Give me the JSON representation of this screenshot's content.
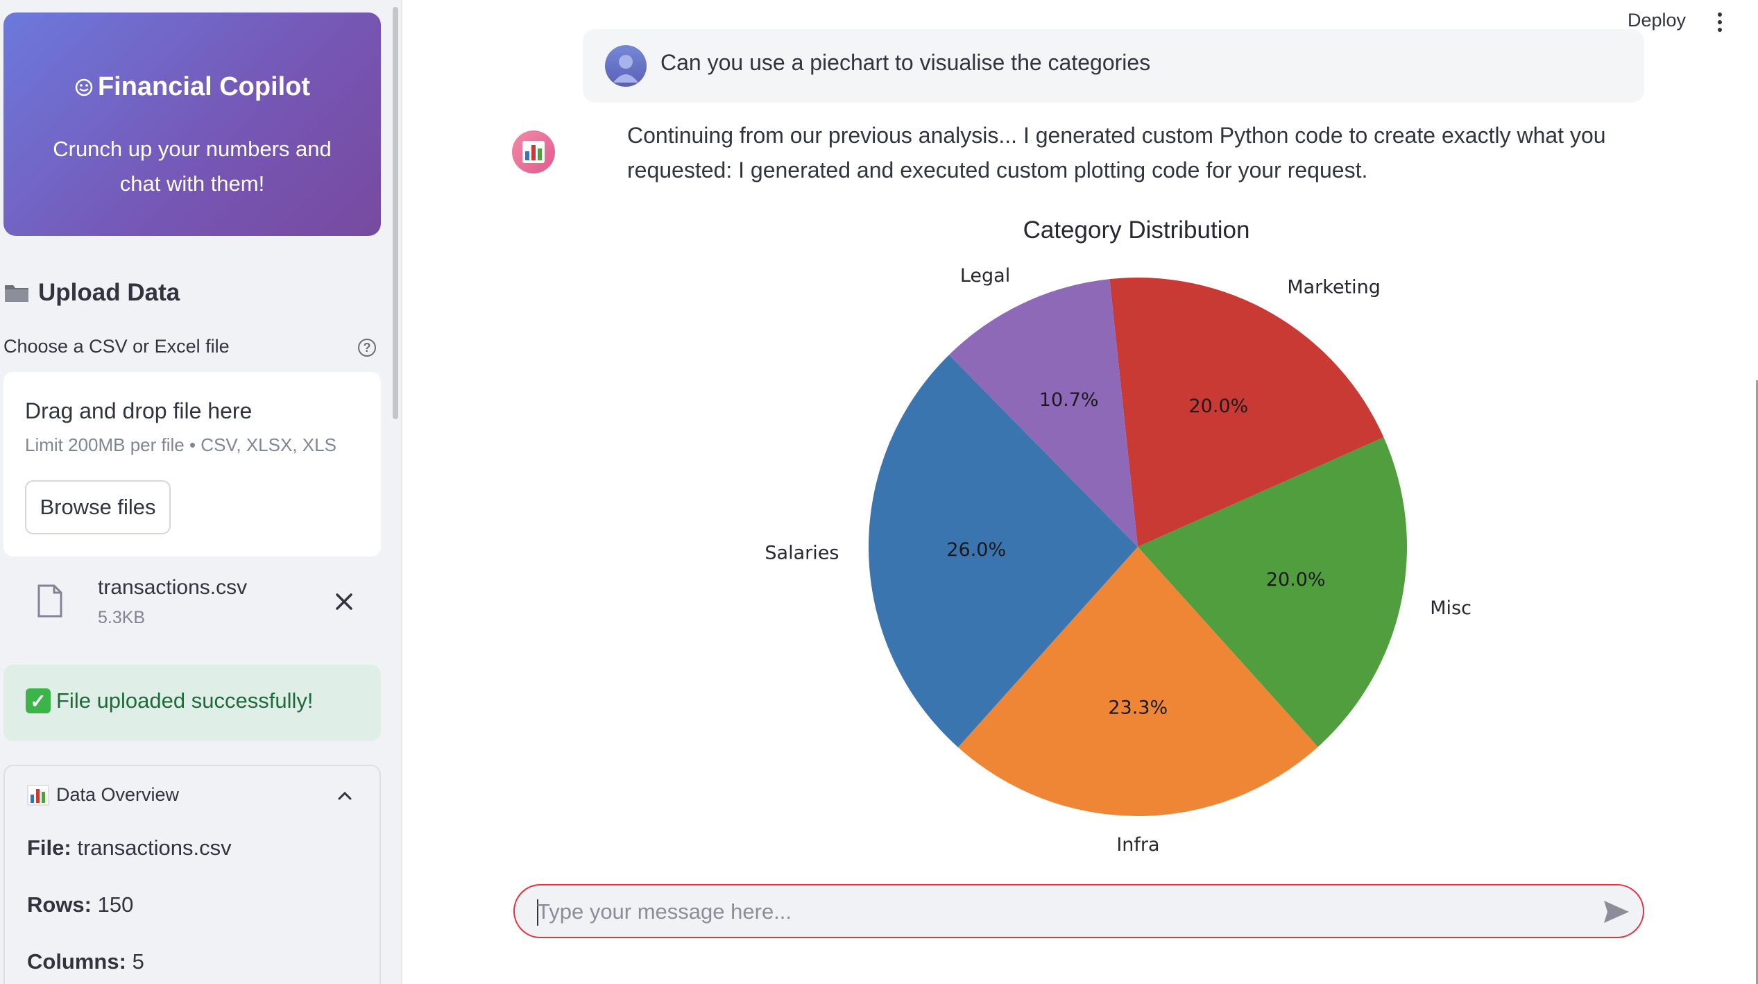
{
  "sidebar": {
    "hero_title": "Financial Copilot",
    "hero_subtitle": "Crunch up your numbers and chat with them!",
    "upload_title": "Upload Data",
    "file_label": "Choose a CSV or Excel file",
    "dropzone_title": "Drag and drop file here",
    "dropzone_limit": "Limit 200MB per file • CSV, XLSX, XLS",
    "browse_label": "Browse files",
    "file_name": "transactions.csv",
    "file_size": "5.3KB",
    "success_message": "File uploaded successfully!",
    "overview_title": "Data Overview",
    "overview": {
      "file_key": "File:",
      "file_val": "transactions.csv",
      "rows_key": "Rows:",
      "rows_val": "150",
      "cols_key": "Columns:",
      "cols_val": "5"
    }
  },
  "topbar": {
    "deploy_label": "Deploy"
  },
  "chat": {
    "user_message": "Can you use a piechart to visualise the categories",
    "bot_message": "Continuing from our previous analysis... I generated custom Python code to create exactly what you requested: I generated and executed custom plotting code for your request.",
    "input_placeholder": "Type your message here..."
  },
  "chart_data": {
    "type": "pie",
    "title": "Category Distribution",
    "categories": [
      "Marketing",
      "Misc",
      "Infra",
      "Salaries",
      "Legal"
    ],
    "values": [
      20.0,
      20.0,
      23.3,
      26.0,
      10.7
    ],
    "pct_labels": [
      "20.0%",
      "20.0%",
      "23.3%",
      "26.0%",
      "10.7%"
    ],
    "colors": [
      "#c83a33",
      "#519e3e",
      "#ef8636",
      "#3b75af",
      "#8d69b8"
    ],
    "start_angle_deg": 96,
    "direction": "clockwise"
  },
  "colors": {
    "accent": "#e4313d",
    "hero_start": "#6c79dc",
    "hero_end": "#774a9f",
    "success_bg": "#dfeee6"
  }
}
